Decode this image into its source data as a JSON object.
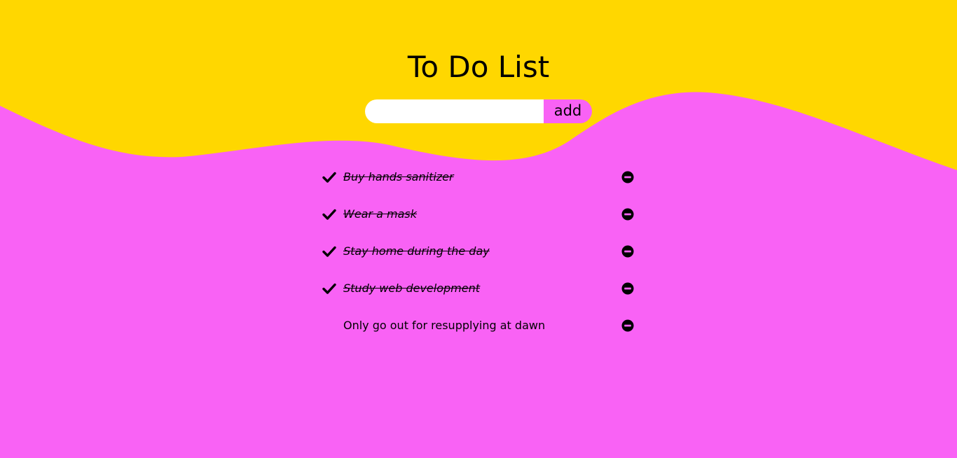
{
  "app": {
    "title": "To Do List"
  },
  "form": {
    "input_value": "",
    "input_placeholder": "",
    "add_label": "add"
  },
  "colors": {
    "top_background": "#FFD700",
    "main_background": "#F962F5",
    "input_background": "#FFFFFF",
    "add_button_background": "#F962F5",
    "text": "#000000"
  },
  "icons": {
    "check": "check-icon",
    "remove": "minus-circle-icon"
  },
  "todos": [
    {
      "text": "Buy hands sanitizer",
      "done": true
    },
    {
      "text": "Wear a mask",
      "done": true
    },
    {
      "text": "Stay home during the day",
      "done": true
    },
    {
      "text": "Study web development",
      "done": true
    },
    {
      "text": "Only go out for resupplying at dawn",
      "done": false
    }
  ]
}
